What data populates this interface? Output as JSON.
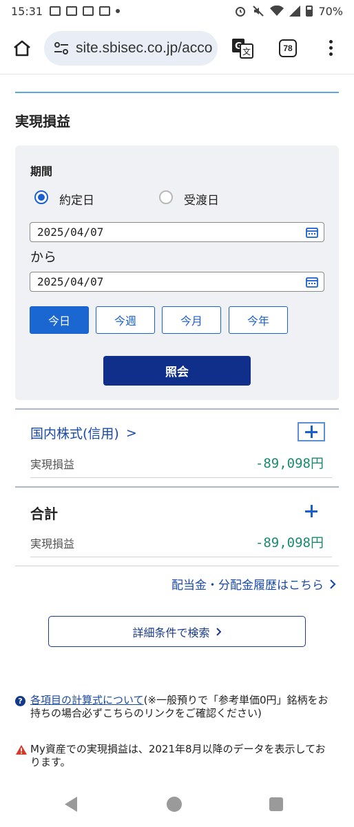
{
  "status_bar": {
    "time": "15:31",
    "battery": "70%"
  },
  "browser": {
    "url": "site.sbisec.co.jp/acco",
    "tab_count": "78"
  },
  "page": {
    "section_title": "実現損益"
  },
  "filter": {
    "period_label": "期間",
    "radio_options": [
      {
        "label": "約定日",
        "selected": true
      },
      {
        "label": "受渡日",
        "selected": false
      }
    ],
    "date_from": "2025/04/07",
    "from_connector": "から",
    "date_to": "2025/04/07",
    "quick_buttons": [
      {
        "label": "今日",
        "active": true
      },
      {
        "label": "今週",
        "active": false
      },
      {
        "label": "今月",
        "active": false
      },
      {
        "label": "今年",
        "active": false
      }
    ],
    "submit_label": "照会"
  },
  "domestic": {
    "title": "国内株式(信用)",
    "chevron": ">",
    "row_label": "実現損益",
    "row_value": "-89,098円"
  },
  "total": {
    "title": "合計",
    "row_label": "実現損益",
    "row_value": "-89,098円"
  },
  "links": {
    "history": "配当金・分配金履歴はこちら",
    "advanced_search": "詳細条件で検索"
  },
  "notes": {
    "note1_link": "各項目の計算式について",
    "note1_text": "(※一般預りで「参考単価0円」銘柄をお持ちの場合必ずこちらのリンクをご確認ください)",
    "note2_text": "My資産での実現損益は、2021年8月以降のデータを表示しております。"
  },
  "colors": {
    "accent_blue": "#1a5fd0",
    "submit_navy": "#0f2f8a",
    "value_green": "#1a8a6e",
    "panel_bg": "#f0f1f4",
    "warning_red": "#d23a2c"
  }
}
